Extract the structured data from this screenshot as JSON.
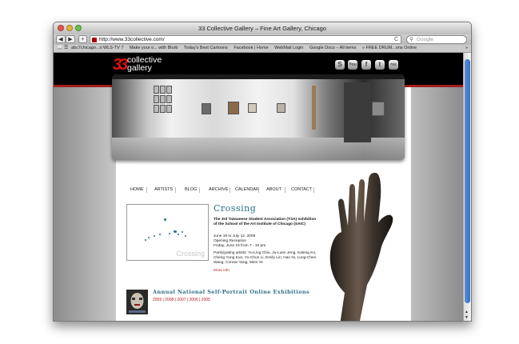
{
  "window": {
    "title": "33 Collective Gallery – Fine Art Gallery, Chicago"
  },
  "toolbar": {
    "back": "◀",
    "forward": "▶",
    "add": "+",
    "url": "http://www.33collective.com/",
    "reload": "C",
    "search_placeholder": "Google",
    "search_icon": "search-icon"
  },
  "bookmarks": {
    "items": [
      "abc7chicago...o WLS-TV 7",
      "Make your o... with Blurb",
      "Today's Best Cartoons",
      "Facebook | Home",
      "WebMail Login",
      "Google Docs – All items",
      "» FREE DRUM...ons Online"
    ],
    "more": "»"
  },
  "site": {
    "logo_num": "33",
    "logo_line1": "collective",
    "logo_line2": "gallery",
    "social": [
      "S",
      "You",
      "f",
      "t",
      "rss"
    ],
    "nav": [
      "HOME",
      "ARTISTS",
      "BLOG",
      "ARCHIVE",
      "CALENDAR",
      "ABOUT",
      "CONTACT"
    ],
    "feature": {
      "thumb_caption": "Crossing",
      "heading": "Crossing",
      "subtitle": "The 3rd Taiwanese Student Association (TSA) exhibition of the School of the Art Institute of Chicago (SAIC)",
      "dates": "June 19 to July 12, 2009",
      "reception_label": "Opening Reception",
      "reception_time": "Friday, June 19 from 7 - 10 pm",
      "artists": "Participating artists: Yu-Ling Chiu, Ju-Luen Jeng, Kaleng Ko, Cheng Yung Kuo, Yu-Chun Li, Emily Lin, Hao Ni, Lung-Chen Wang, Connie Yang, Mimi Ye",
      "more": "More info"
    },
    "annual": {
      "heading": "Annual National Self-Portrait Online Exhibitions",
      "years": "2009 | 2008 | 2007 | 2006 | 2005"
    }
  },
  "colors": {
    "accent_teal": "#2b6f86",
    "link_red": "#b21e1e",
    "header_black": "#000000",
    "scroll_blue": "#3470c9"
  }
}
